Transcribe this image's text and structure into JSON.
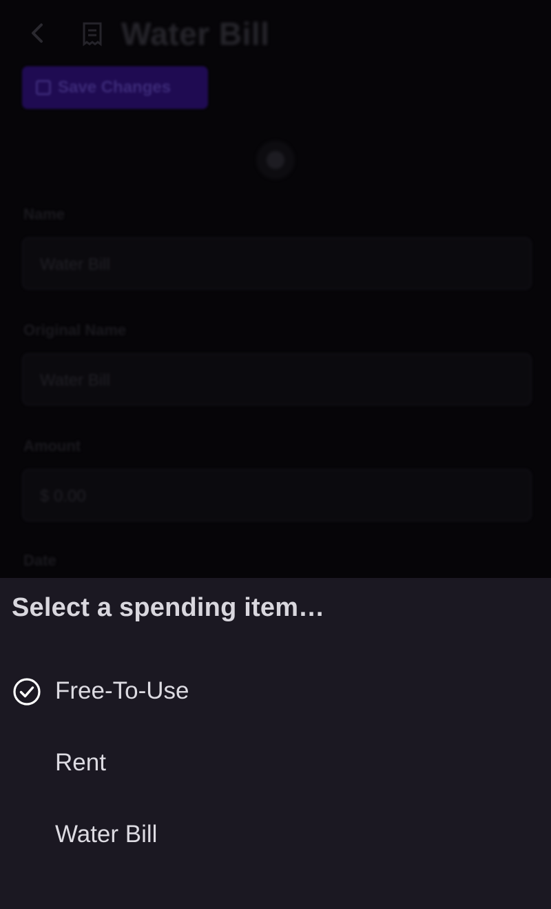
{
  "header": {
    "title": "Water Bill",
    "save_label": "Save Changes"
  },
  "form": {
    "name_label": "Name",
    "name_value": "Water Bill",
    "original_name_label": "Original Name",
    "original_name_value": "Water Bill",
    "amount_label": "Amount",
    "amount_value": "$ 0.00",
    "date_label": "Date"
  },
  "sheet": {
    "title": "Select a spending item…",
    "options": [
      {
        "label": "Free-To-Use",
        "selected": true
      },
      {
        "label": "Rent",
        "selected": false
      },
      {
        "label": "Water Bill",
        "selected": false
      }
    ]
  },
  "colors": {
    "sheet_bg": "#1b1822",
    "backdrop": "#060508",
    "accent": "#1f0b52"
  }
}
